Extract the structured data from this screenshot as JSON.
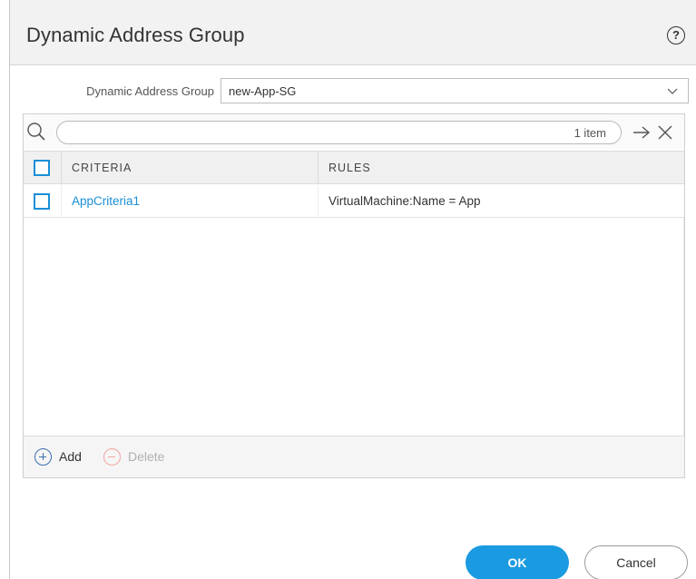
{
  "dialog": {
    "title": "Dynamic Address Group",
    "help_icon": "?"
  },
  "group": {
    "label": "Dynamic Address Group",
    "value": "new-App-SG"
  },
  "search": {
    "placeholder": "",
    "count_text": "1 item"
  },
  "table": {
    "columns": [
      "CRITERIA",
      "RULES"
    ],
    "rows": [
      {
        "criteria": "AppCriteria1",
        "rules": "VirtualMachine:Name = App"
      }
    ]
  },
  "footer": {
    "add_label": "Add",
    "delete_label": "Delete"
  },
  "buttons": {
    "ok_label": "OK",
    "cancel_label": "Cancel"
  },
  "colors": {
    "accent": "#1a9ae0",
    "link": "#1a8fd6",
    "delete_disabled": "#f2a3a3"
  }
}
